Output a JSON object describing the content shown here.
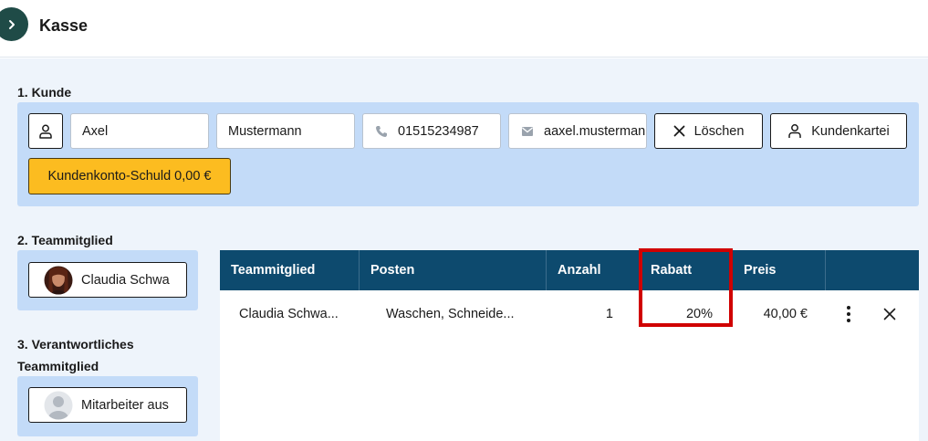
{
  "header": {
    "title": "Kasse"
  },
  "section1": {
    "label": "1. Kunde",
    "first_name": "Axel",
    "last_name": "Mustermann",
    "phone": "01515234987",
    "email": "aaxel.mustermann",
    "clear_label": "Löschen",
    "customer_file_label": "Kundenkartei",
    "debt_label": "Kundenkonto-Schuld 0,00 €"
  },
  "section2": {
    "label": "2. Teammitglied",
    "member": "Claudia Schwa"
  },
  "section3": {
    "label_line1": "3. Verantwortliches",
    "label_line2": "Teammitglied",
    "member": "Mitarbeiter aus"
  },
  "table": {
    "columns": [
      "Teammitglied",
      "Posten",
      "Anzahl",
      "Rabatt",
      "Preis"
    ],
    "rows": [
      {
        "member": "Claudia Schwa...",
        "item": "Waschen, Schneide...",
        "qty": "1",
        "discount": "20%",
        "price": "40,00 €"
      }
    ]
  },
  "colors": {
    "accent_dark": "#1f4b47",
    "table_header": "#0d4a6e",
    "panel": "#c3dbf8",
    "debt_button": "#fcbc20",
    "highlight": "#d00000"
  }
}
